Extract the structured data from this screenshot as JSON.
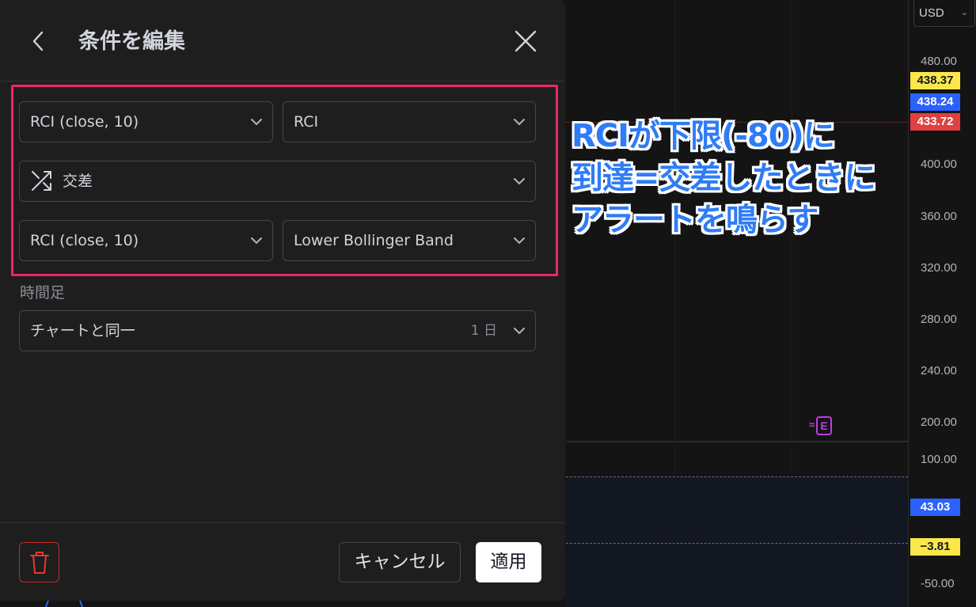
{
  "dialog": {
    "title": "条件を編集",
    "condition": {
      "source1": "RCI (close, 10)",
      "source1_plot": "RCI",
      "operator": "交差",
      "operator_icon": "crossing-arrows-icon",
      "source2": "RCI (close, 10)",
      "source2_plot": "Lower Bollinger Band"
    },
    "timeframe": {
      "label": "時間足",
      "value": "チャートと同一",
      "interval": "1 日"
    },
    "footer": {
      "cancel_label": "キャンセル",
      "apply_label": "適用"
    },
    "highlight_color": "#f0246a"
  },
  "chart": {
    "currency": "USD",
    "price_ticks": [
      "480.00",
      "400.00",
      "360.00",
      "320.00",
      "280.00",
      "240.00",
      "200.00"
    ],
    "indicator_ticks": [
      "100.00",
      "-50.00"
    ],
    "price_badges": [
      {
        "value": "438.37",
        "bg": "#fbe74a",
        "fg": "#131722"
      },
      {
        "value": "438.24",
        "bg": "#2962ff",
        "fg": "#ffffff"
      },
      {
        "value": "433.72",
        "bg": "#e0403f",
        "fg": "#ffffff"
      }
    ],
    "indicator_badges": [
      {
        "value": "43.03",
        "bg": "#2962ff",
        "fg": "#ffffff"
      },
      {
        "value": "−3.81",
        "bg": "#fbe74a",
        "fg": "#131722"
      }
    ],
    "earnings_marker": "E"
  },
  "annotation": {
    "lines": [
      "RCIが下限(-80)に",
      "到達=交差したときに",
      "アラートを鳴らす"
    ],
    "color": "#2f7cf6"
  }
}
